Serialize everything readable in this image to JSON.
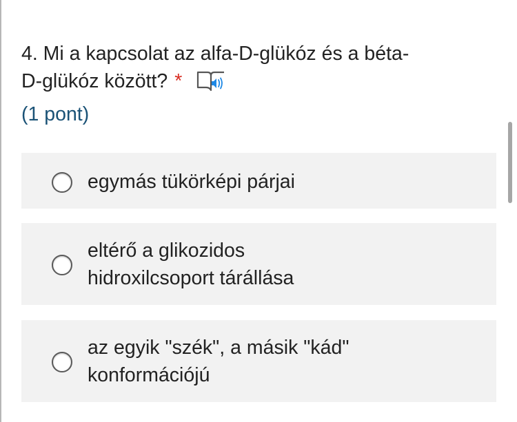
{
  "question": {
    "lines": [
      "4. Mi a kapcsolat az alfa-D-glükóz és a béta-",
      "D-glükóz között?"
    ],
    "required_marker": "*",
    "reader_icon": "immersive-reader-icon",
    "points": "(1 pont)"
  },
  "options": [
    {
      "lines": [
        "egymás tükörképi párjai"
      ],
      "selected": false
    },
    {
      "lines": [
        "eltérő a glikozidos",
        "hidroxilcsoport tárállása"
      ],
      "selected": false
    },
    {
      "lines": [
        "az egyik \"szék\", a másik \"kád\"",
        "konformációjú"
      ],
      "selected": false
    }
  ],
  "colors": {
    "text": "#222222",
    "points": "#1a5276",
    "required": "#d93025",
    "option_bg": "#f2f2f2",
    "icon_accent": "#1e88e5"
  }
}
